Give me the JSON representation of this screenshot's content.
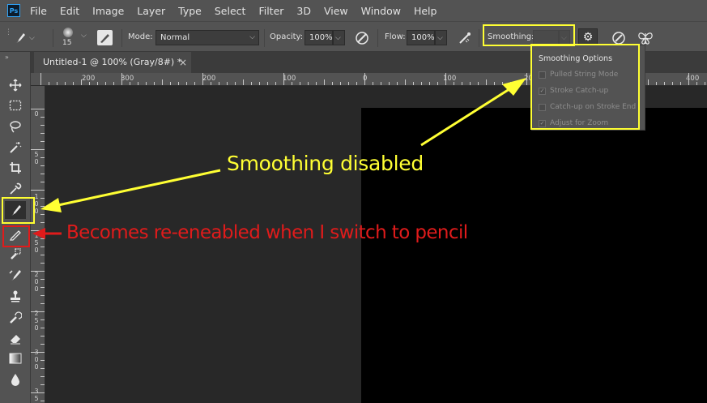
{
  "app": {
    "logo_text": "Ps"
  },
  "menu": [
    "File",
    "Edit",
    "Image",
    "Layer",
    "Type",
    "Select",
    "Filter",
    "3D",
    "View",
    "Window",
    "Help"
  ],
  "options": {
    "brush_size": "15",
    "mode_label": "Mode:",
    "mode_value": "Normal",
    "opacity_label": "Opacity:",
    "opacity_value": "100%",
    "flow_label": "Flow:",
    "flow_value": "100%",
    "smoothing_label": "Smoothing:",
    "smoothing_value": ""
  },
  "document_tab": {
    "title": "Untitled-1 @ 100% (Gray/8#) *",
    "close": "×"
  },
  "ruler_h": [
    "200",
    "300",
    "200",
    "100",
    "0",
    "100",
    "200",
    "300",
    "400"
  ],
  "ruler_v": [
    "0",
    "5 0",
    "1 0 0",
    "1 5 0",
    "2 0 0",
    "2 5 0",
    "3 0 0",
    "3 5 0"
  ],
  "smoothing_popup": {
    "title": "Smoothing Options",
    "options": [
      {
        "label": "Pulled String Mode",
        "checked": false
      },
      {
        "label": "Stroke Catch-up",
        "checked": true
      },
      {
        "label": "Catch-up on Stroke End",
        "checked": false
      },
      {
        "label": "Adjust for Zoom",
        "checked": true
      }
    ]
  },
  "annotations": {
    "smoothing_disabled": "Smoothing disabled",
    "reenabled": "Becomes re-eneabled when I switch to pencil"
  },
  "colors": {
    "annotation_yellow": "#ffff33",
    "annotation_red": "#e01b1b",
    "ui_panel": "#535353",
    "canvas_doc": "#000000"
  },
  "icons": {
    "tools": [
      "move-icon",
      "marquee-icon",
      "lasso-icon",
      "magic-wand-icon",
      "crop-icon",
      "eyedropper-icon",
      "brush-icon",
      "pencil-icon",
      "healing-brush-icon",
      "mixer-brush-icon",
      "clone-stamp-icon",
      "history-brush-icon",
      "eraser-icon",
      "gradient-icon",
      "blur-icon"
    ]
  }
}
